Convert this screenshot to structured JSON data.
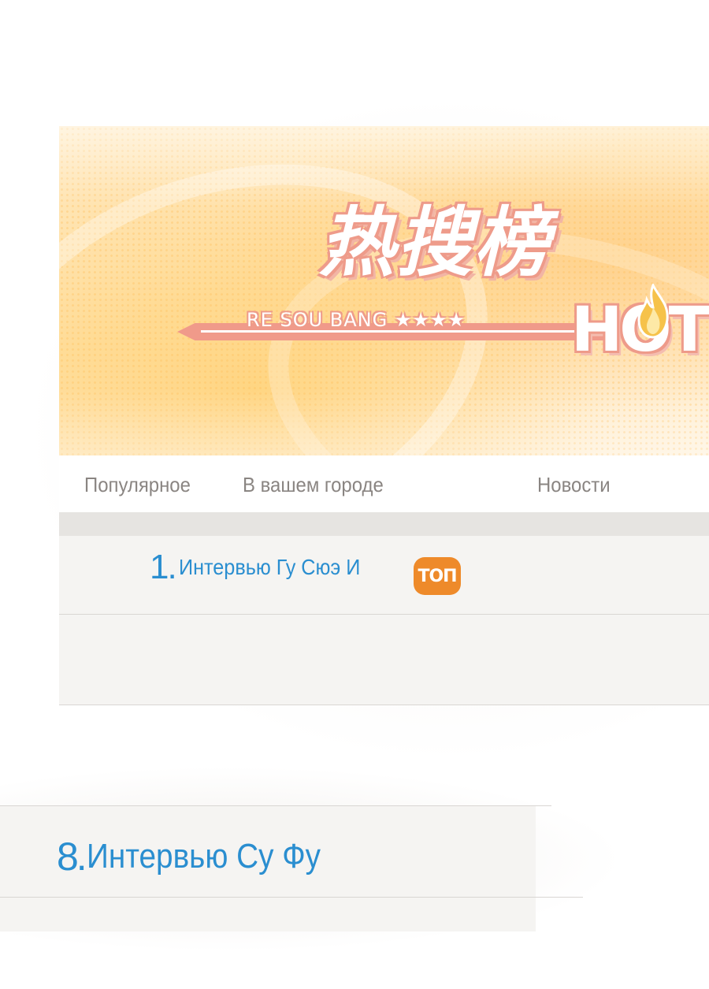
{
  "banner": {
    "logo_chinese": "热搜榜",
    "logo_subtitle": "RE SOU BANG ★★★★",
    "logo_hot": "HOT"
  },
  "tabs": [
    {
      "label": "Популярное"
    },
    {
      "label": "В вашем городе"
    },
    {
      "label": "Новости"
    }
  ],
  "list": {
    "items": [
      {
        "rank": "1.",
        "title": "Интервью Гу Сюэ И",
        "badge": "ТОП"
      },
      {
        "rank": "8.",
        "title": "Интервью Су Фу"
      }
    ]
  },
  "colors": {
    "accent_blue": "#2a8ed0",
    "badge_orange": "#ee8a2a",
    "logo_pink": "#ee9b8a",
    "tab_gray": "#8a8582"
  },
  "icons": [
    "flame-icon"
  ]
}
